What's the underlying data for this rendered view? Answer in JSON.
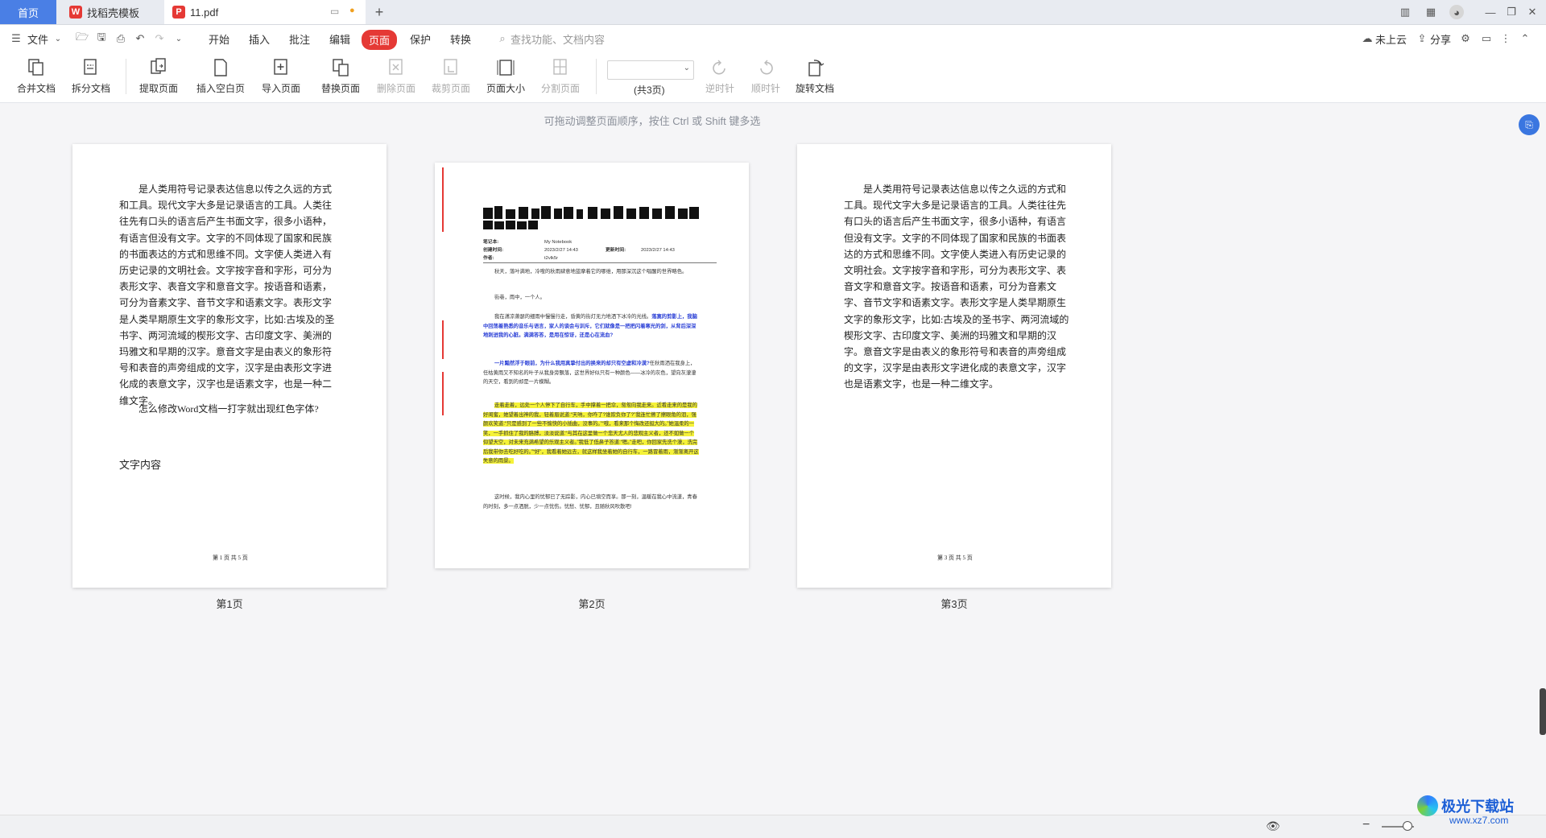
{
  "tabs": {
    "home": "首页",
    "template": "找稻壳模板",
    "doc": "11.pdf"
  },
  "menu": {
    "file": "文件",
    "items": [
      "开始",
      "插入",
      "批注",
      "编辑",
      "页面",
      "保护",
      "转换"
    ],
    "active": "页面",
    "search_placeholder": "查找功能、文档内容",
    "cloud": "未上云",
    "share": "分享"
  },
  "toolbar": {
    "merge": "合并文档",
    "split": "拆分文档",
    "extract": "提取页面",
    "insert_blank": "插入空白页",
    "import": "导入页面",
    "replace": "替换页面",
    "delete": "删除页面",
    "crop": "裁剪页面",
    "page_size": "页面大小",
    "split_page": "分割页面",
    "page_select_value": "",
    "total_pages": "(共3页)",
    "ccw": "逆时针",
    "cw": "顺时针",
    "rotate_doc": "旋转文档"
  },
  "canvas": {
    "hint": "可拖动调整页面顺序，按住 Ctrl 或 Shift 键多选"
  },
  "pages": [
    {
      "label": "第1页",
      "paragraph": "是人类用符号记录表达信息以传之久远的方式和工具。现代文字大多是记录语言的工具。人类往往先有口头的语言后产生书面文字，很多小语种，有语言但没有文字。文字的不同体现了国家和民族的书面表达的方式和思维不同。文字使人类进入有历史记录的文明社会。文字按字音和字形，可分为表形文字、表音文字和意音文字。按语音和语素，可分为音素文字、音节文字和语素文字。表形文字是人类早期原生文字的象形文字，比如:古埃及的圣书字、两河流域的楔形文字、古印度文字、美洲的玛雅文和早期的汉字。意音文字是由表义的象形符号和表音的声旁组成的文字，汉字是由表形文字进化成的表意文字，汉字也是语素文字，也是一种二维文字。",
      "question": "怎么修改Word文档一打字就出现红色字体?",
      "content_label": "文字内容",
      "footer": "第 1 页 共 5 页"
    },
    {
      "label": "第2页",
      "meta": {
        "notebook_label": "笔记本:",
        "notebook_value": "My Notebook",
        "created_label": "创建时间:",
        "created_value": "2023/2/27 14:43",
        "updated_label": "更新时间:",
        "updated_value": "2023/2/27 14:43",
        "author_label": "作者:",
        "author_value": "t2vlk5r"
      },
      "paras": [
        "秋天，落叶满地，冷嗖的秋雨肆意地蓝摩着它的哪维，用那深沉这个唱醒的世界略色。",
        "街巷，雨中，一个人。",
        "我在潇凉萧瑟的细雨中慢慢行走，昏黄的街灯无力地洒下冰冷的光线。",
        "落寞的剪影上，我脑中回荡着熟悉的音乐与语言，家人的谈会与训斥，它们就像是一把把闪着寒光的剑，从背后深深地刺进我的心脏。满满答答，是用在惊讶，还是心在流血?",
        "一片黯然浮于眼前，为什么我用真挚付出的换来的却只有空虚和冷漠?",
        "任秋雨洒在我身上，任枯黄雨又不知名的叶子从我身旁飘落，这世界好似只有一种颜色——冰冷的灰色，望向灰濛濛的天空，看到的却是一片模糊。",
        "走着走着，远处一个人停下了自行车，手中撑着一把伞，匆匆向我走来。近看走来的是我的好闺蜜，她望着出神的我，轻着眉说道:“天呐，你咋了?谁欺负你了?”我连忙擦了擦眼角的泪，强颜欢笑道:“只是感到了一些不愉快的小插曲，没事的。”“哦，看来那个悔改还挺大的。”她温柔的一笑，一手抓住了我的胳膊，淡淡说道:“与其在这里做一个悲天尤人的悲观主义者，还不如做一个仰望天空，对未来充满希望的乐观主义者。”我低了低鼻子答道:“嗯。”走吧，你回家先洗个澡，洗完后我带你去吃好吃的。”“好”，我看着她远去，就这样我坐着她的自行车，一路冒着雨，渐渐离开这失意的雨景。",
        "这时候，我内心里的忧郁已了无踪影，内心已填空而享。那一刻，温暖在我心中流漾，青春的时刻，多一点洒脱，少一点忧伤。忧愁、忧郁，且随秋风吹散吧!"
      ]
    },
    {
      "label": "第3页",
      "paragraph": "是人类用符号记录表达信息以传之久远的方式和工具。现代文字大多是记录语言的工具。人类往往先有口头的语言后产生书面文字，很多小语种，有语言但没有文字。文字的不同体现了国家和民族的书面表达的方式和思维不同。文字使人类进入有历史记录的文明社会。文字按字音和字形，可分为表形文字、表音文字和意音文字。按语音和语素，可分为音素文字、音节文字和语素文字。表形文字是人类早期原生文字的象形文字，比如:古埃及的圣书字、两河流域的楔形文字、古印度文字、美洲的玛雅文和早期的汉字。意音文字是由表义的象形符号和表音的声旁组成的文字，汉字是由表形文字进化成的表意文字，汉字也是语素文字，也是一种二维文字。",
      "footer": "第 3 页 共 5 页"
    }
  ],
  "watermark": {
    "site": "极光下载站",
    "url": "www.xz7.com"
  }
}
